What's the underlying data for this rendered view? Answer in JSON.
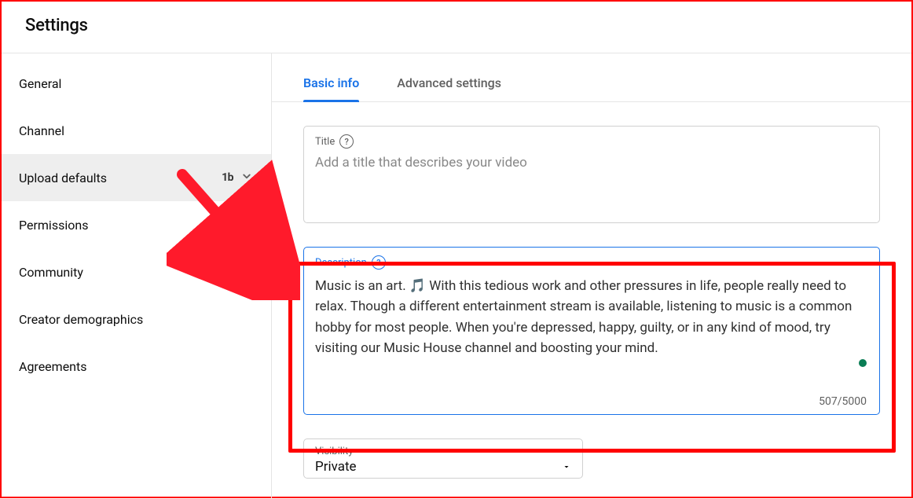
{
  "header": {
    "title": "Settings"
  },
  "sidebar": {
    "items": [
      {
        "label": "General"
      },
      {
        "label": "Channel"
      },
      {
        "label": "Upload defaults",
        "badge": "1b",
        "expandable": true,
        "active": true
      },
      {
        "label": "Permissions"
      },
      {
        "label": "Community"
      },
      {
        "label": "Creator demographics"
      },
      {
        "label": "Agreements"
      }
    ]
  },
  "tabs": {
    "items": [
      {
        "label": "Basic info",
        "active": true
      },
      {
        "label": "Advanced settings"
      }
    ]
  },
  "title_field": {
    "label": "Title",
    "placeholder": "Add a title that describes your video",
    "value": ""
  },
  "description_field": {
    "label": "Description",
    "value": "Music is an art. 🎵 With this tedious work and other pressures in life, people really need to relax. Though a different entertainment stream is available, listening to music is a common hobby for most people. When you're depressed, happy, guilty, or in any kind of mood, try visiting our Music House channel and boosting your mind.",
    "counter": "507/5000"
  },
  "visibility_field": {
    "label": "Visibility",
    "value": "Private"
  },
  "icons": {
    "help": "?"
  }
}
